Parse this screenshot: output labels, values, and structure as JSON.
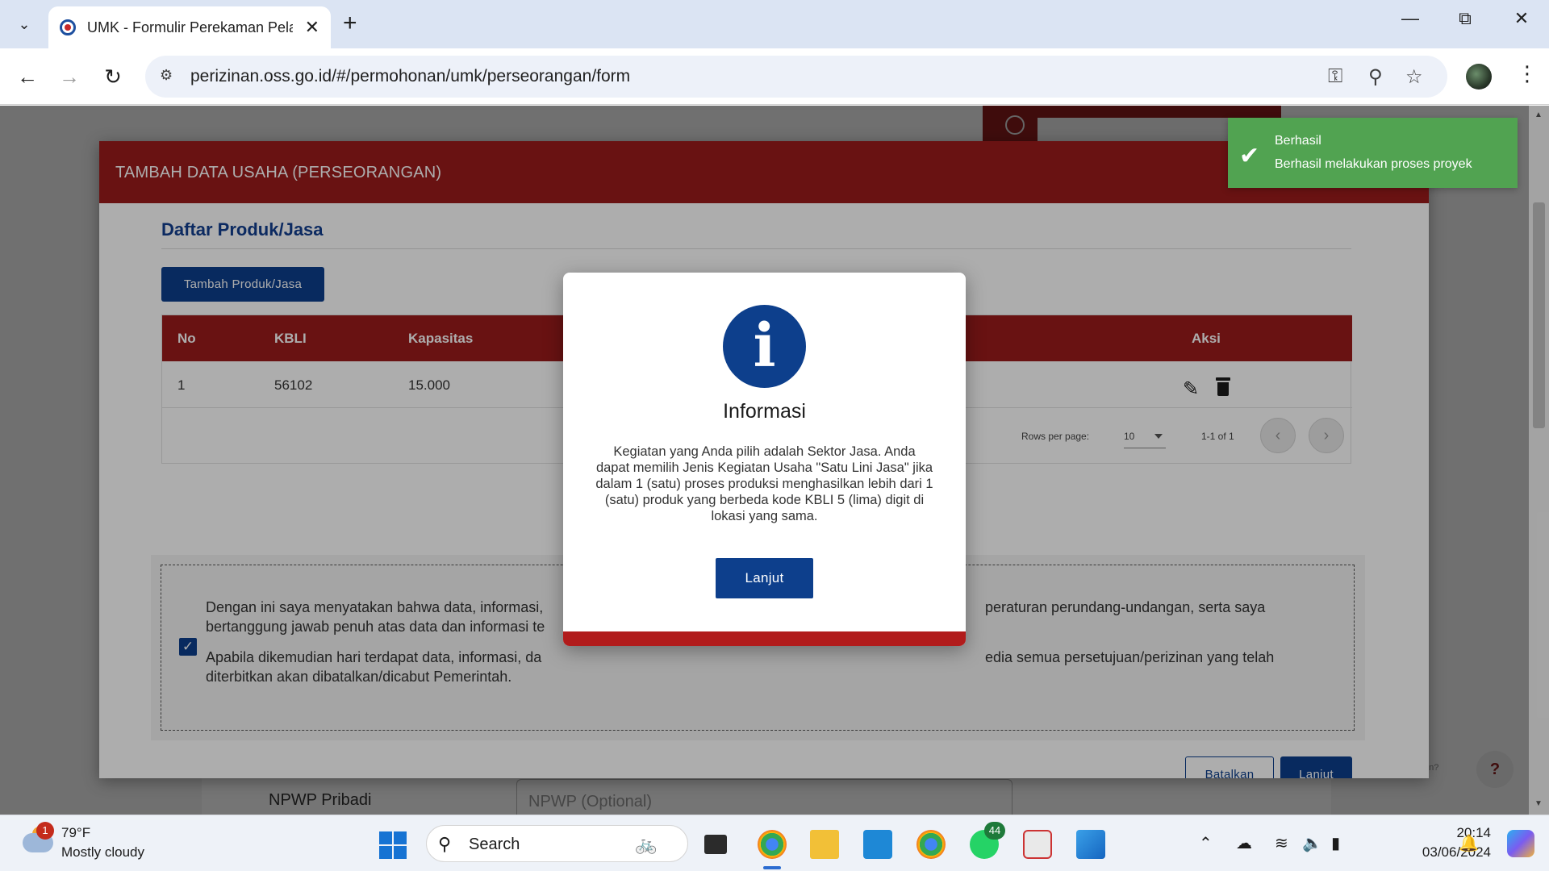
{
  "browser": {
    "tab_title": "UMK - Formulir Perekaman Pela",
    "url": "perizinan.oss.go.id/#/permohonan/umk/perseorangan/form",
    "icons": {
      "tab_search": "chevron-down-icon",
      "new_tab": "plus-icon",
      "back": "arrow-left-icon",
      "forward": "arrow-right-icon",
      "reload": "reload-icon",
      "site_info": "tune-icon",
      "passwords": "key-icon",
      "zoom": "zoom-icon",
      "bookmark": "star-icon",
      "menu": "kebab-icon"
    }
  },
  "modal": {
    "title": "TAMBAH DATA USAHA (PERSEORANGAN)",
    "section_title": "Daftar Produk/Jasa",
    "add_button": "Tambah Produk/Jasa",
    "table": {
      "headers": {
        "no": "No",
        "kbli": "KBLI",
        "kapasitas": "Kapasitas",
        "aksi": "Aksi"
      },
      "rows": [
        {
          "no": "1",
          "kbli": "56102",
          "kapasitas": "15.000"
        }
      ],
      "pagination": {
        "rows_per_page_label": "Rows per page:",
        "rows_per_page_value": "10",
        "range": "1-1 of 1"
      }
    },
    "declaration": {
      "checked": true,
      "paragraph1_left": "Dengan ini saya menyatakan bahwa data, informasi,",
      "paragraph1_right": "peraturan perundang-undangan, serta saya",
      "paragraph1_line2": "bertanggung jawab penuh atas data dan informasi te",
      "paragraph2_left": "Apabila dikemudian hari terdapat data, informasi, da",
      "paragraph2_right": "edia semua persetujuan/perizinan yang telah",
      "paragraph2_line2": "diterbitkan akan dibatalkan/dicabut Pemerintah."
    },
    "cancel_button": "Batalkan",
    "next_button": "Lanjut"
  },
  "background": {
    "npwp_label": "NPWP Pribadi",
    "npwp_placeholder": "NPWP (Optional)",
    "help_text": "an?"
  },
  "dialog": {
    "title": "Informasi",
    "message": "Kegiatan yang Anda pilih adalah Sektor Jasa. Anda dapat memilih Jenis Kegiatan Usaha \"Satu Lini Jasa\" jika dalam 1 (satu) proses produksi menghasilkan lebih dari 1 (satu) produk yang berbeda kode KBLI 5 (lima) digit di lokasi yang sama.",
    "button": "Lanjut",
    "icon_letter": "i"
  },
  "toast": {
    "title": "Berhasil",
    "message": "Berhasil melakukan proses proyek",
    "color": "#51a351"
  },
  "taskbar": {
    "weather_temp": "79°F",
    "weather_desc": "Mostly cloudy",
    "weather_badge": "1",
    "search_placeholder": "Search",
    "whatsapp_badge": "44",
    "time": "20:14",
    "date": "03/06/2024"
  },
  "colors": {
    "header_red": "#9b1b1b",
    "primary_blue": "#0d3f8c",
    "success_green": "#51a351"
  }
}
